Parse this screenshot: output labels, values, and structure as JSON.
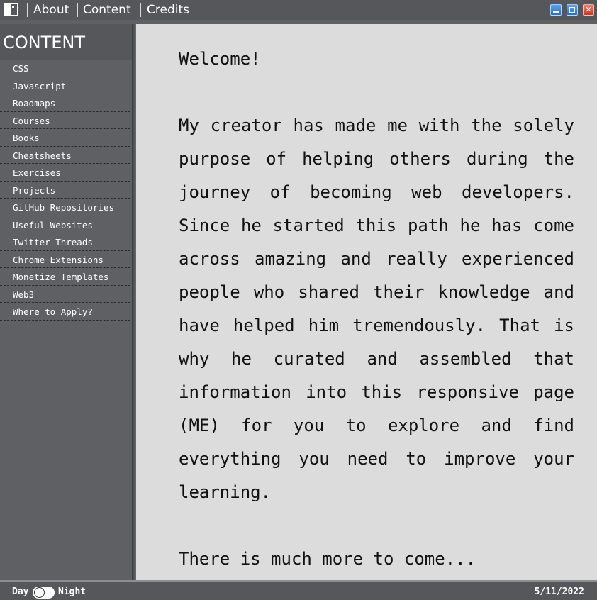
{
  "topbar": {
    "app_icon": "window-icon",
    "nav": [
      "About",
      "Content",
      "Credits"
    ],
    "window_buttons": [
      "minimize-icon",
      "maximize-icon",
      "close-icon"
    ]
  },
  "sidebar": {
    "title": "CONTENT",
    "items": [
      "CSS",
      "Javascript",
      "Roadmaps",
      "Courses",
      "Books",
      "Cheatsheets",
      "Exercises",
      "Projects",
      "GitHub Repositories",
      "Useful Websites",
      "Twitter Threads",
      "Chrome Extensions",
      "Monetize Templates",
      "Web3",
      "Where to Apply?"
    ]
  },
  "main": {
    "welcome": "Welcome!",
    "intro": "My creator has made me with the solely purpose of helping others during the journey of becoming web developers. Since he started this path he has come across amazing and really experienced people who shared their knowledge and have helped him tremendously. That is why he curated and assembled that information into this responsive page (ME) for you to explore and find everything you need to improve your learning.",
    "more": "There is much more to come..."
  },
  "bottombar": {
    "day_label": "Day",
    "night_label": "Night",
    "date": "5/11/2022"
  },
  "colors": {
    "bar": "#56575a",
    "sidebar": "#5f6063",
    "main_bg": "#dcdcdd",
    "text": "#111111"
  }
}
